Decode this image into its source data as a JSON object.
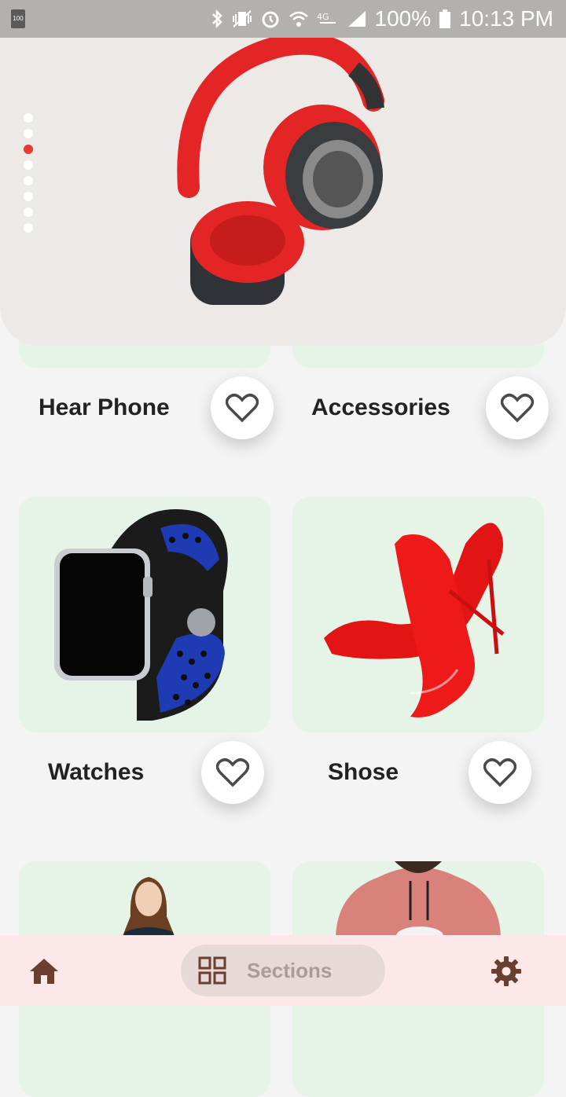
{
  "status_bar": {
    "battery_percent": "100%",
    "time": "10:13 PM",
    "left_battery_label": "100"
  },
  "hero": {
    "image": "red-black-headphones-image",
    "slides_count": 8,
    "active_slide_index": 2
  },
  "products": [
    {
      "title": "Hear Phone",
      "image": "headphone-image",
      "favorite": false
    },
    {
      "title": "Accessories",
      "image": "accessories-image",
      "favorite": false
    },
    {
      "title": "Watches",
      "image": "smartwatch-image",
      "favorite": false
    },
    {
      "title": "Shose",
      "image": "red-heels-image",
      "favorite": false
    }
  ],
  "bottom_nav": {
    "home_icon": "home-icon",
    "sections_label": "Sections",
    "sections_icon": "grid-icon",
    "settings_icon": "gear-icon"
  },
  "colors": {
    "accent": "#e53b32",
    "card_background": "#e5f4e6",
    "nav_background": "#fce8e8",
    "pill_background": "#e6d9d7"
  }
}
